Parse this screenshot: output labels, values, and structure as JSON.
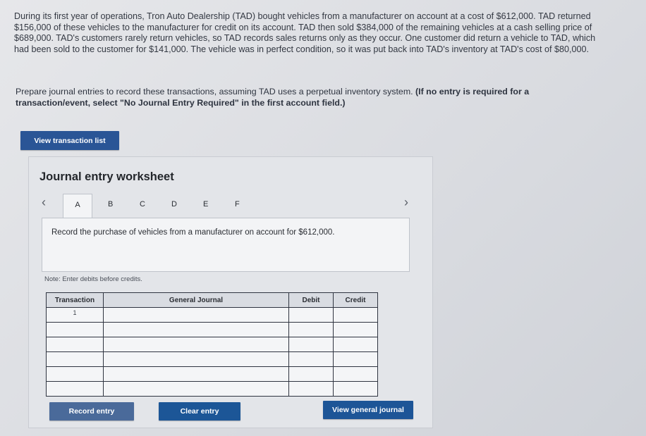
{
  "problem": {
    "text": "During its first year of operations, Tron Auto Dealership (TAD) bought vehicles from a manufacturer on account at a cost of $612,000. TAD returned $156,000 of these vehicles to the manufacturer for credit on its account. TAD then sold $384,000 of the remaining vehicles at a cash selling price of $689,000. TAD's customers rarely return vehicles, so TAD records sales returns only as they occur. One customer did return a vehicle to TAD, which had been sold to the customer for $141,000. The vehicle was in perfect condition, so it was put back into TAD's inventory at TAD's cost of $80,000."
  },
  "instructions": {
    "text": "Prepare journal entries to record these transactions, assuming TAD uses a perpetual inventory system.",
    "bold": "(If no entry is required for a transaction/event, select \"No Journal Entry Required\" in the first account field.)"
  },
  "buttons": {
    "view_transaction_list": "View transaction list",
    "record_entry": "Record entry",
    "clear_entry": "Clear entry",
    "view_general_journal": "View general journal"
  },
  "worksheet": {
    "title": "Journal entry worksheet",
    "tabs": [
      "A",
      "B",
      "C",
      "D",
      "E",
      "F"
    ],
    "active_tab": "A",
    "description": "Record the purchase of vehicles from a manufacturer on account for $612,000.",
    "note": "Note: Enter debits before credits.",
    "table": {
      "headers": [
        "Transaction",
        "General Journal",
        "Debit",
        "Credit"
      ],
      "rows": [
        {
          "transaction": "1"
        },
        {
          "transaction": ""
        },
        {
          "transaction": ""
        },
        {
          "transaction": ""
        },
        {
          "transaction": ""
        },
        {
          "transaction": ""
        }
      ]
    }
  },
  "colors": {
    "button_primary": "#1d5597",
    "button_disabled": "#4a6a9a"
  }
}
